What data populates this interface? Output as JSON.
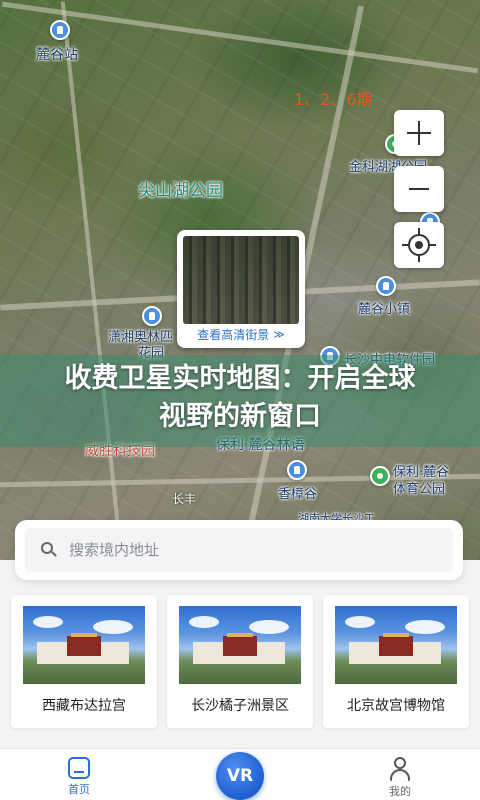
{
  "map": {
    "labels": {
      "station": "麓谷站",
      "phase": "1、2、6期",
      "park": "尖山湖公园",
      "jinke": "金科湖湖公园",
      "jinke_suffix": "园",
      "lugu_town": "麓谷小镇",
      "xiaoxiang_line1": "潇湘奥林匹",
      "xiaoxiang_line2": "花园",
      "changsha_software": "长沙中电软件园",
      "weisheng": "威胜科技园",
      "baoli_park": "保利·麓谷林语",
      "changfeng": "长丰",
      "xiangu": "香樟谷",
      "baoli_gym_line1": "保利·麓谷",
      "baoli_gym_line2": "体育公园",
      "hunan_univ": "湖南大学长沙工"
    },
    "streetview": {
      "label": "查看高清街景",
      "arrow": "≫"
    },
    "controls": {
      "zoom_in": "zoom-in",
      "zoom_out": "zoom-out",
      "locate": "locate"
    }
  },
  "headline": {
    "line1": "收费卫星实时地图：开启全球",
    "line2": "视野的新窗口"
  },
  "search": {
    "placeholder": "搜索境内地址"
  },
  "scenic_spots": [
    {
      "name": "西藏布达拉宫"
    },
    {
      "name": "长沙橘子洲景区"
    },
    {
      "name": "北京故宫博物馆"
    }
  ],
  "nav": {
    "home_label": "首页",
    "vr_label": "VR",
    "mine_label": "我的"
  },
  "colors": {
    "accent": "#2a6fd6",
    "headline_band": "#3c8c6e",
    "phase_label": "#e25a1a",
    "park_label": "#1f8d7c"
  }
}
